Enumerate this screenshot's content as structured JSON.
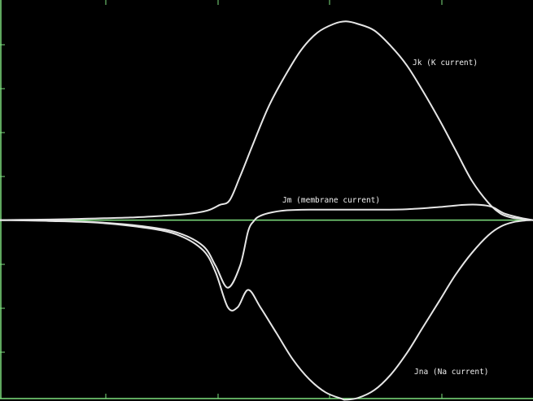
{
  "chart_data": {
    "type": "line",
    "title": "",
    "xlabel": "",
    "ylabel": "",
    "grid": false,
    "xlim": [
      0,
      655
    ],
    "ylim": [
      -4.15,
      5.05
    ],
    "series": [
      {
        "name": "Jk (K current)",
        "color": "#e6e6e6",
        "x": [
          0,
          40,
          80,
          120,
          160,
          200,
          230,
          255,
          270,
          282,
          295,
          310,
          330,
          350,
          370,
          390,
          410,
          425,
          440,
          460,
          480,
          500,
          520,
          540,
          560,
          580,
          600,
          615,
          628,
          640,
          655
        ],
        "y": [
          0,
          0.01,
          0.02,
          0.04,
          0.06,
          0.1,
          0.14,
          0.22,
          0.35,
          0.45,
          1.0,
          1.7,
          2.6,
          3.3,
          3.9,
          4.3,
          4.5,
          4.56,
          4.5,
          4.35,
          4.0,
          3.55,
          2.95,
          2.3,
          1.6,
          0.9,
          0.4,
          0.15,
          0.06,
          0.03,
          0
        ]
      },
      {
        "name": "Jm (membrane current)",
        "color": "#e6e6e6",
        "x": [
          0,
          60,
          120,
          180,
          220,
          250,
          265,
          280,
          295,
          305,
          312,
          318,
          330,
          350,
          380,
          420,
          460,
          500,
          540,
          570,
          590,
          605,
          620,
          640,
          655
        ],
        "y": [
          0,
          -0.01,
          -0.05,
          -0.15,
          -0.3,
          -0.6,
          -1.05,
          -1.55,
          -1.05,
          -0.25,
          -0.02,
          0.08,
          0.16,
          0.22,
          0.24,
          0.24,
          0.24,
          0.25,
          0.3,
          0.35,
          0.35,
          0.3,
          0.15,
          0.05,
          0
        ]
      },
      {
        "name": "Jna (Na current)",
        "color": "#e6e6e6",
        "x": [
          0,
          60,
          120,
          180,
          220,
          250,
          265,
          280,
          292,
          305,
          320,
          340,
          360,
          380,
          400,
          420,
          425,
          440,
          460,
          480,
          500,
          520,
          540,
          560,
          580,
          600,
          615,
          630,
          645,
          655
        ],
        "y": [
          0,
          -0.02,
          -0.06,
          -0.18,
          -0.35,
          -0.7,
          -1.2,
          -2.0,
          -2.0,
          -1.6,
          -2.0,
          -2.6,
          -3.2,
          -3.65,
          -3.95,
          -4.1,
          -4.12,
          -4.08,
          -3.9,
          -3.55,
          -3.05,
          -2.45,
          -1.85,
          -1.25,
          -0.75,
          -0.35,
          -0.15,
          -0.05,
          -0.01,
          0
        ]
      }
    ],
    "annotations": [
      {
        "text": "Jk (K current)",
        "series": 0
      },
      {
        "text": "Jm (membrane current)",
        "series": 1
      },
      {
        "text": "Jna (Na current)",
        "series": 2
      }
    ]
  }
}
